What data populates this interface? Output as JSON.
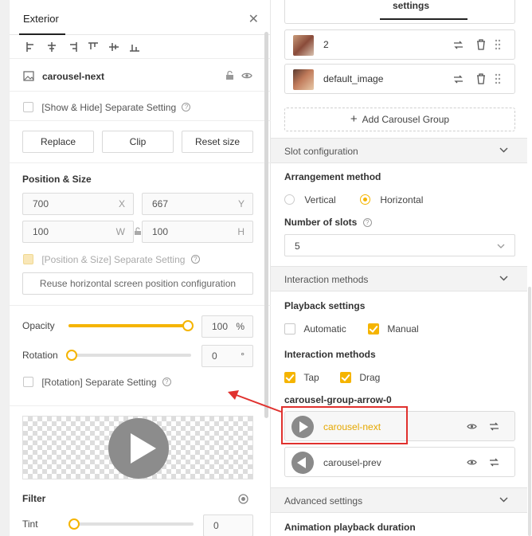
{
  "left": {
    "tab_title": "Exterior",
    "element_name": "carousel-next",
    "show_hide_label": "[Show & Hide] Separate Setting",
    "buttons": {
      "replace": "Replace",
      "clip": "Clip",
      "reset": "Reset size"
    },
    "position_size": {
      "title": "Position & Size",
      "x": {
        "value": "700",
        "unit": "X"
      },
      "y": {
        "value": "667",
        "unit": "Y"
      },
      "w": {
        "value": "100",
        "unit": "W"
      },
      "h": {
        "value": "100",
        "unit": "H"
      },
      "separate_label": "[Position & Size] Separate Setting",
      "reuse_label": "Reuse horizontal screen position configuration"
    },
    "opacity": {
      "label": "Opacity",
      "value": "100",
      "unit": "%",
      "fraction": 1.0
    },
    "rotation": {
      "label": "Rotation",
      "value": "0",
      "unit": "°",
      "fraction": 0.0,
      "separate_label": "[Rotation] Separate Setting"
    },
    "filter": {
      "title": "Filter"
    },
    "tint": {
      "label": "Tint",
      "value": "0",
      "fraction": 0.0
    }
  },
  "right": {
    "top_tab": "settings",
    "carousel_items": [
      {
        "label": "2"
      },
      {
        "label": "default_image"
      }
    ],
    "add_group": "Add Carousel Group",
    "slot_section": "Slot configuration",
    "arrangement_label": "Arrangement method",
    "arrangement_options": [
      {
        "label": "Vertical",
        "selected": false
      },
      {
        "label": "Horizontal",
        "selected": true
      }
    ],
    "slots_label": "Number of slots",
    "slots_value": "5",
    "interaction_section": "Interaction methods",
    "playback_label": "Playback settings",
    "playback_options": [
      {
        "label": "Automatic",
        "checked": false
      },
      {
        "label": "Manual",
        "checked": true
      }
    ],
    "interaction_label": "Interaction methods",
    "interaction_options": [
      {
        "label": "Tap",
        "checked": true
      },
      {
        "label": "Drag",
        "checked": true
      }
    ],
    "group_label": "carousel-group-arrow-0",
    "arrow_items": [
      {
        "label": "carousel-next",
        "active": true
      },
      {
        "label": "carousel-prev",
        "active": false
      }
    ],
    "advanced_section": "Advanced settings",
    "animation_label": "Animation playback duration"
  },
  "colors": {
    "accent": "#f5b400",
    "highlight_border": "#e0312e",
    "arrow": "#e0312e"
  }
}
